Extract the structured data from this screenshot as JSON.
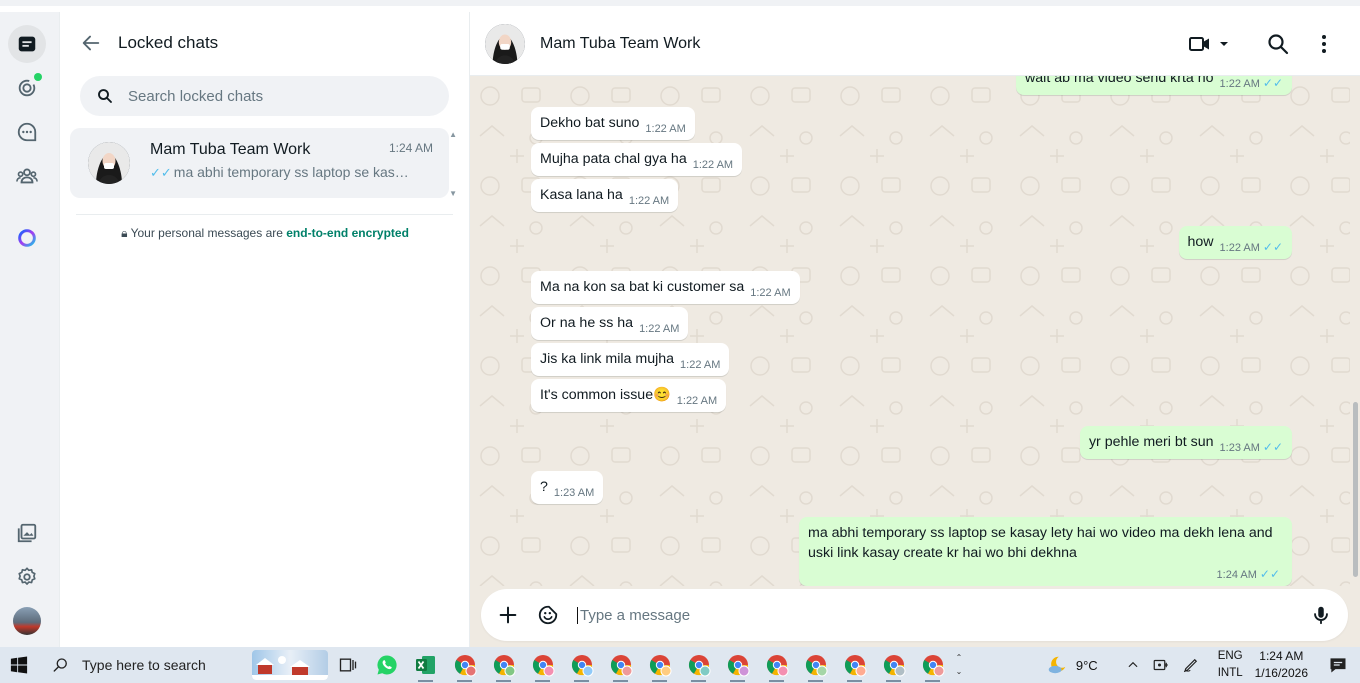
{
  "sidebar": {
    "icons": [
      "chats-icon",
      "status-icon",
      "channels-icon",
      "communities-icon",
      "meta-ai-icon",
      "media-icon",
      "settings-icon",
      "profile-avatar"
    ]
  },
  "list": {
    "title": "Locked chats",
    "search_placeholder": "Search locked chats",
    "chats": [
      {
        "name": "Mam Tuba Team Work",
        "time": "1:24 AM",
        "preview": "ma abhi temporary ss laptop se kasay lety hai wo video ma dekh lena and uski link kasay create kr hai wo bhi dekhna"
      }
    ],
    "encryption_prefix": "Your personal messages are ",
    "encryption_link": "end-to-end encrypted"
  },
  "conversation": {
    "contact_name": "Mam Tuba Team Work",
    "messages": [
      {
        "dir": "out",
        "text": "wait ab ma video send krta ho",
        "time": "1:22 AM"
      },
      {
        "dir": "in",
        "text": "Dekho bat suno",
        "time": "1:22 AM"
      },
      {
        "dir": "in",
        "text": "Mujha pata chal gya ha",
        "time": "1:22 AM"
      },
      {
        "dir": "in",
        "text": "Kasa lana ha",
        "time": "1:22 AM"
      },
      {
        "dir": "out",
        "text": "how",
        "time": "1:22 AM"
      },
      {
        "dir": "in",
        "text": "Ma na kon sa bat ki customer sa",
        "time": "1:22 AM"
      },
      {
        "dir": "in",
        "text": "Or na he ss ha",
        "time": "1:22 AM"
      },
      {
        "dir": "in",
        "text": "Jis ka link mila mujha",
        "time": "1:22 AM"
      },
      {
        "dir": "in",
        "text": "It's common issue😊",
        "time": "1:22 AM"
      },
      {
        "dir": "out",
        "text": "yr pehle meri bt sun",
        "time": "1:23 AM"
      },
      {
        "dir": "in",
        "text": "?",
        "time": "1:23 AM"
      },
      {
        "dir": "out",
        "text": "ma abhi temporary ss laptop se kasay lety hai wo video ma dekh lena and uski link kasay create kr hai wo bhi dekhna",
        "time": "1:24 AM"
      }
    ],
    "composer_placeholder": "Type a message"
  },
  "taskbar": {
    "search_placeholder": "Type here to search",
    "weather": "9°C",
    "lang_top": "ENG",
    "lang_bottom": "INTL",
    "time": "1:24 AM",
    "date": "1/16/2026",
    "chrome_count": 13
  },
  "colors": {
    "accent_green": "#008069",
    "outgoing_bubble": "#d9fdd3",
    "read_tick": "#53bdeb",
    "chat_bg": "#efeae2"
  }
}
